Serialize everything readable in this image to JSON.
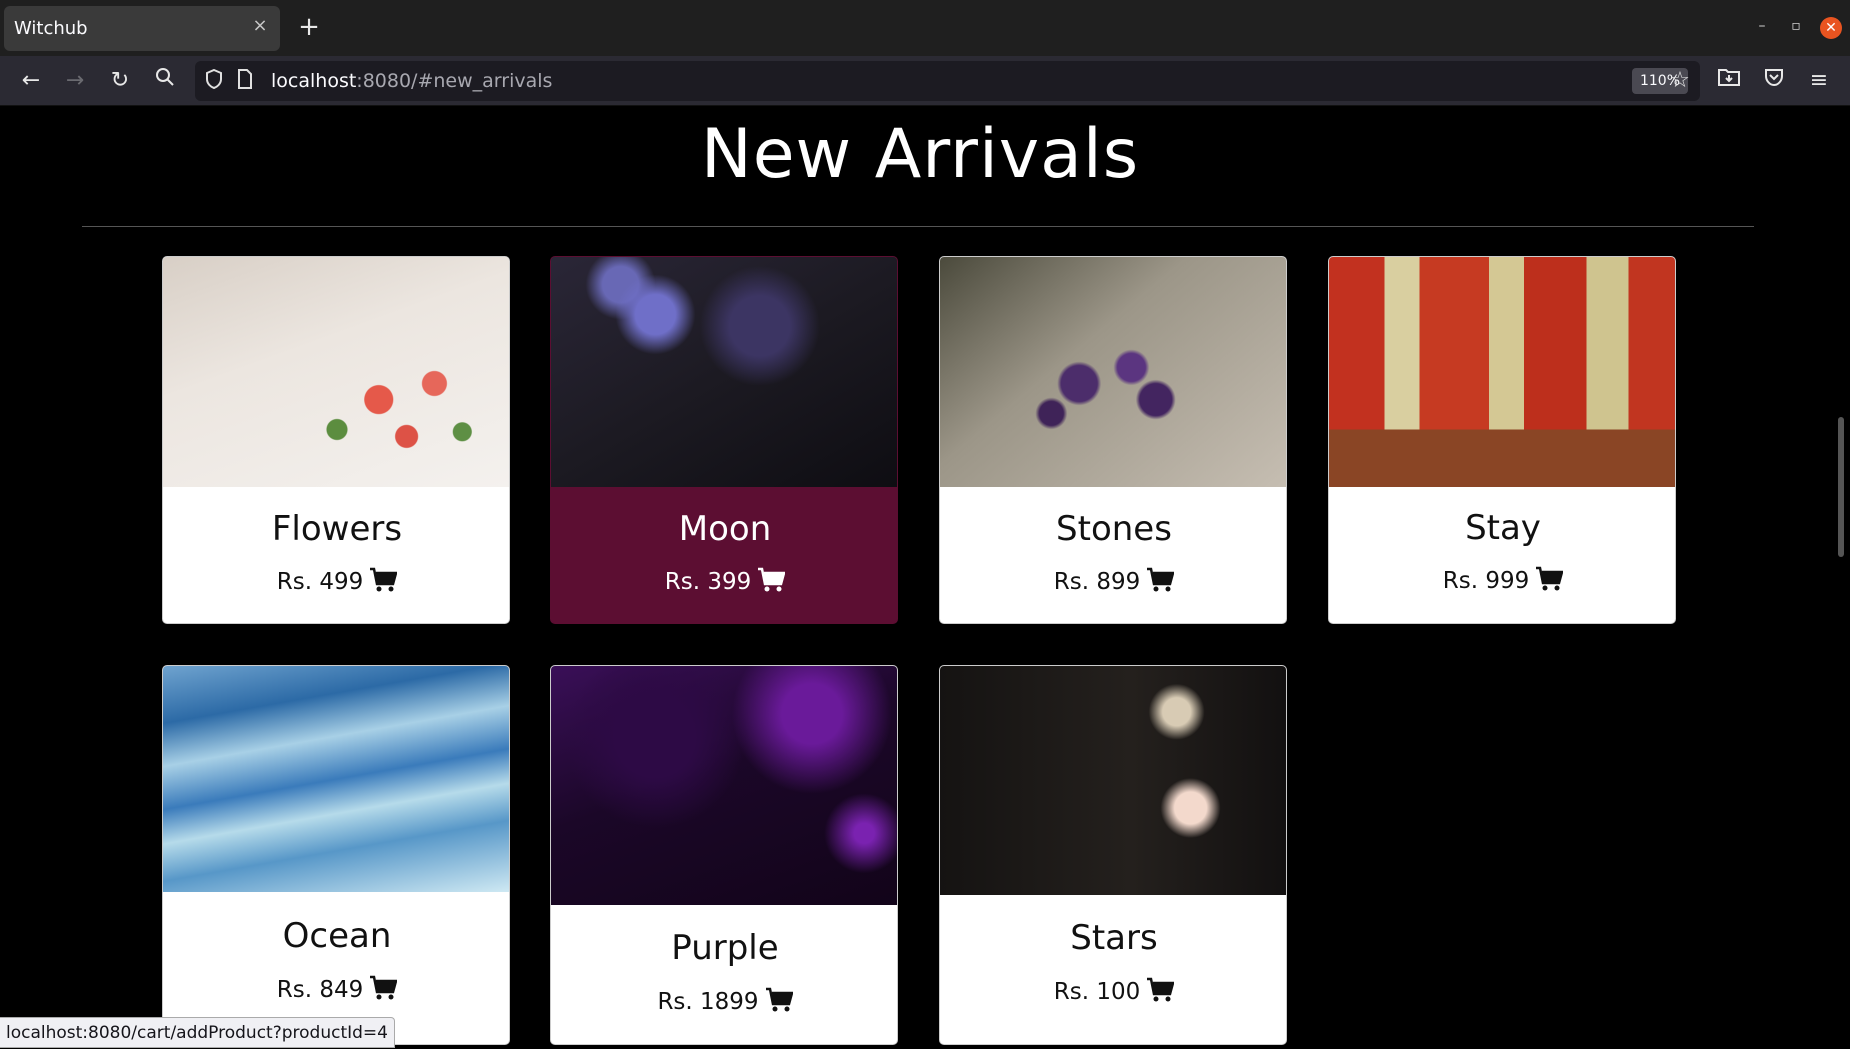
{
  "browser": {
    "tab_title": "Witchub",
    "tab_close": "×",
    "new_tab": "+",
    "url_host": "localhost",
    "url_rest": ":8080/#new_arrivals",
    "zoom": "110%",
    "status_url": "localhost:8080/cart/addProduct?productId=4"
  },
  "page": {
    "title": "New Arrivals"
  },
  "products": [
    {
      "name": "Flowers",
      "price": "Rs. 499"
    },
    {
      "name": "Moon",
      "price": "Rs. 399"
    },
    {
      "name": "Stones",
      "price": "Rs. 899"
    },
    {
      "name": "Stay",
      "price": "Rs. 999"
    },
    {
      "name": "Ocean",
      "price": "Rs. 849"
    },
    {
      "name": "Purple",
      "price": "Rs. 1899"
    },
    {
      "name": "Stars",
      "price": "Rs. 100"
    }
  ],
  "colors": {
    "highlight_card": "#5c0e32",
    "page_background": "#000000"
  }
}
